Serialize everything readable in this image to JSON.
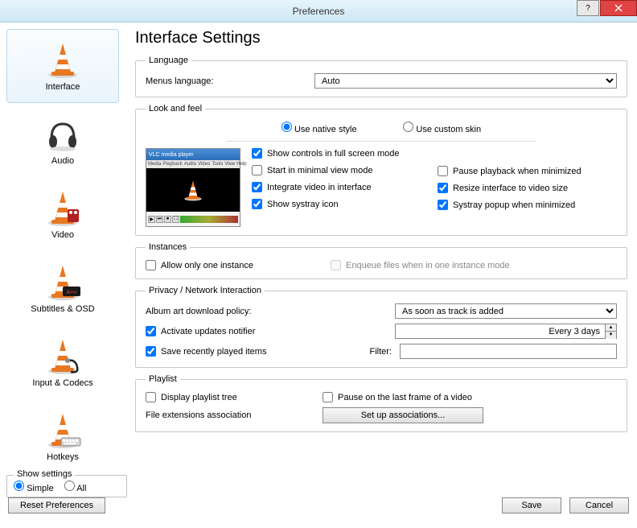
{
  "window": {
    "title": "Preferences"
  },
  "sidebar": {
    "items": [
      {
        "label": "Interface"
      },
      {
        "label": "Audio"
      },
      {
        "label": "Video"
      },
      {
        "label": "Subtitles & OSD"
      },
      {
        "label": "Input & Codecs"
      },
      {
        "label": "Hotkeys"
      }
    ],
    "show_settings": {
      "legend": "Show settings",
      "simple": "Simple",
      "all": "All"
    }
  },
  "main": {
    "heading": "Interface Settings",
    "language": {
      "legend": "Language",
      "menus_label": "Menus language:",
      "value": "Auto"
    },
    "lookfeel": {
      "legend": "Look and feel",
      "native": "Use native style",
      "custom": "Use custom skin",
      "checks": {
        "show_controls": "Show controls in full screen mode",
        "start_minimal": "Start in minimal view mode",
        "integrate_video": "Integrate video in interface",
        "show_systray": "Show systray icon",
        "pause_minimized": "Pause playback when minimized",
        "resize_interface": "Resize interface to video size",
        "systray_popup": "Systray popup when minimized"
      },
      "preview_title": "VLC media player"
    },
    "instances": {
      "legend": "Instances",
      "allow_one": "Allow only one instance",
      "enqueue": "Enqueue files when in one instance mode"
    },
    "privacy": {
      "legend": "Privacy / Network Interaction",
      "album_art_label": "Album art download policy:",
      "album_art_value": "As soon as track is added",
      "activate_updates": "Activate updates notifier",
      "update_interval": "Every 3 days",
      "save_recent": "Save recently played items",
      "filter_label": "Filter:"
    },
    "playlist": {
      "legend": "Playlist",
      "display_tree": "Display playlist tree",
      "pause_last_frame": "Pause on the last frame of a video",
      "file_ext_label": "File extensions association",
      "setup_btn": "Set up associations..."
    }
  },
  "footer": {
    "reset": "Reset Preferences",
    "save": "Save",
    "cancel": "Cancel"
  }
}
